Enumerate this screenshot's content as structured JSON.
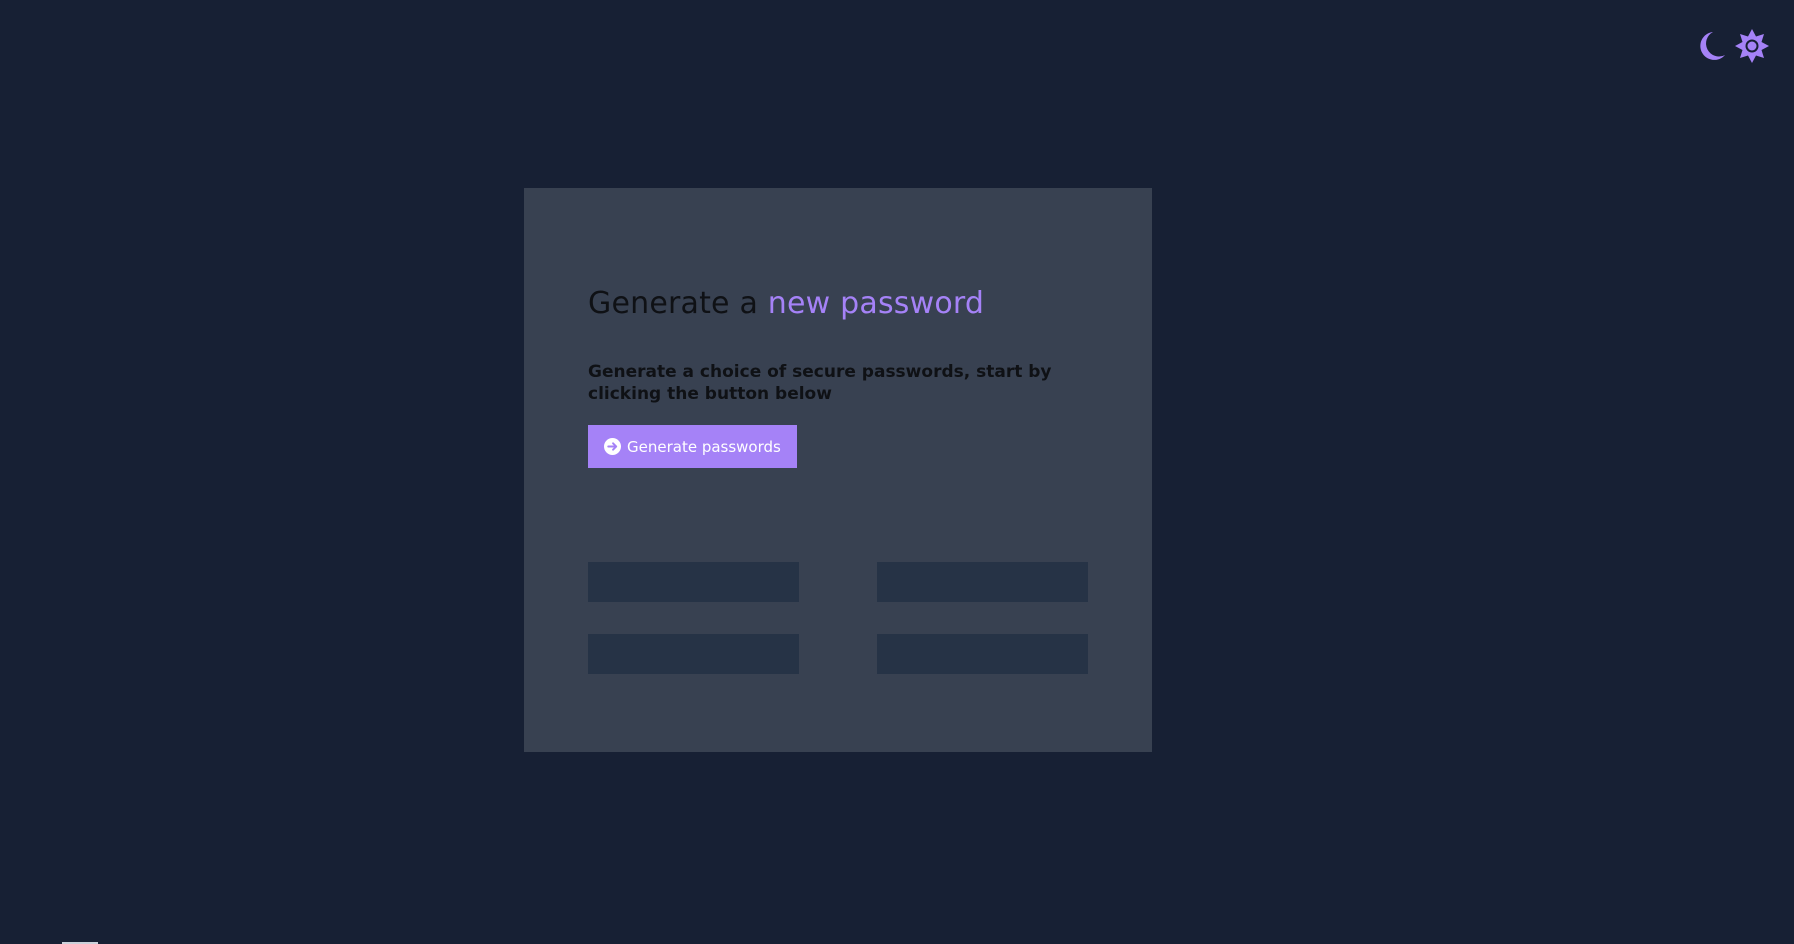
{
  "theme": {
    "background": "#172034",
    "card": "#384151",
    "accent": "#a582f7",
    "slot": "#263346",
    "text": "#0f1115",
    "toggles": [
      {
        "name": "dark-mode",
        "icon": "moon-icon"
      },
      {
        "name": "light-mode",
        "icon": "sun-icon"
      }
    ]
  },
  "main": {
    "title_prefix": "Generate a ",
    "title_accent": "new password",
    "subtitle": "Generate a choice of secure passwords, start by clicking the button below",
    "button": {
      "label": "Generate passwords",
      "icon": "arrow-right-circle-icon"
    },
    "passwords": [
      "",
      "",
      "",
      ""
    ]
  }
}
